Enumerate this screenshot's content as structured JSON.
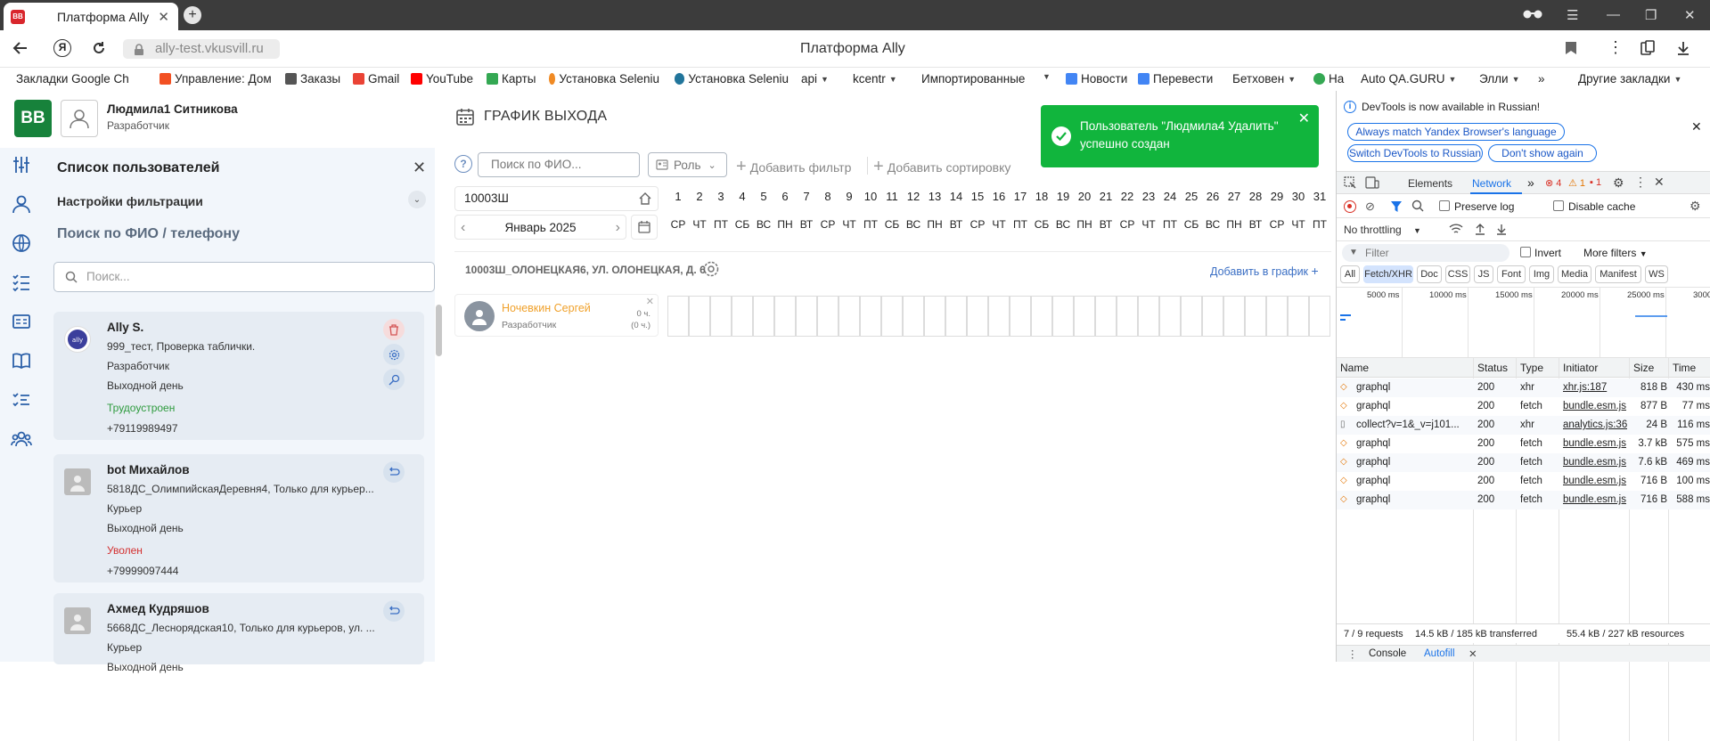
{
  "browser": {
    "tab_title": "Платформа Ally",
    "favicon_text": "BB",
    "url": "ally-test.vkusvill.ru",
    "page_title": "Платформа Ally"
  },
  "bookmarks": [
    {
      "label": "Закладки Google Ch",
      "color": "#4285f4"
    },
    {
      "label": "Управление: Дом",
      "color": "#f25022"
    },
    {
      "label": "Заказы",
      "color": "#555555"
    },
    {
      "label": "Gmail",
      "color": "#ea4335"
    },
    {
      "label": "YouTube",
      "color": "#ff0000"
    },
    {
      "label": "Карты",
      "color": "#34a853"
    },
    {
      "label": "Установка Seleniu",
      "color": "#f08a24"
    },
    {
      "label": "Установка Seleniu",
      "color": "#21759b"
    },
    {
      "label": "api",
      "color": ""
    },
    {
      "label": "kcentr",
      "color": ""
    },
    {
      "label": "Импортированные",
      "color": ""
    },
    {
      "label": "Новости",
      "color": "#4285f4"
    },
    {
      "label": "Перевести",
      "color": "#4285f4"
    },
    {
      "label": "Бетховен",
      "color": ""
    },
    {
      "label": "Ha",
      "color": "#34a853"
    },
    {
      "label": "Auto QA.GURU",
      "color": ""
    },
    {
      "label": "Элли",
      "color": ""
    },
    {
      "label": "»",
      "color": ""
    },
    {
      "label": "Другие закладки",
      "color": ""
    }
  ],
  "app": {
    "logo": "BB",
    "user_name": "Людмила1 Ситникова",
    "user_role": "Разработчик",
    "main_title": "ГРАФИК ВЫХОДА"
  },
  "panel": {
    "title": "Список пользователей",
    "filter_title": "Настройки фильтрации",
    "search_label": "Поиск по ФИО / телефону",
    "search_placeholder": "Поиск...",
    "users": [
      {
        "name": "Ally S.",
        "subtitle": "999_тест, Проверка таблички.",
        "role": "Разработчик",
        "day": "Выходной день",
        "status": "Трудоустроен",
        "status_color": "#2e9b3e",
        "phone": "+79119989497"
      },
      {
        "name": "bot Михайлов",
        "subtitle": "5818ДС_ОлимпийскаяДеревня4, Только для курьер...",
        "role": "Курьер",
        "day": "Выходной день",
        "status": "Уволен",
        "status_color": "#d32f2f",
        "phone": "+79999097444"
      },
      {
        "name": "Ахмед Кудряшов",
        "subtitle": "5668ДС_Леснорядская10, Только для курьеров, ул. ...",
        "role": "Курьер",
        "day": "Выходной день"
      }
    ]
  },
  "toolbar": {
    "search_placeholder": "Поиск по ФИО...",
    "role_label": "Роль",
    "add_filter": "Добавить фильтр",
    "add_sort": "Добавить сортировку"
  },
  "schedule": {
    "store": "10003Ш",
    "month": "Январь 2025",
    "days": [
      "1",
      "2",
      "3",
      "4",
      "5",
      "6",
      "7",
      "8",
      "9",
      "10",
      "11",
      "12",
      "13",
      "14",
      "15",
      "16",
      "17",
      "18",
      "19",
      "20",
      "21",
      "22",
      "23",
      "24",
      "25",
      "26",
      "27",
      "28",
      "29",
      "30",
      "31"
    ],
    "weekdays": [
      "СР",
      "ЧТ",
      "ПТ",
      "СБ",
      "ВС",
      "ПН",
      "ВТ",
      "СР",
      "ЧТ",
      "ПТ",
      "СБ",
      "ВС",
      "ПН",
      "ВТ",
      "СР",
      "ЧТ",
      "ПТ",
      "СБ",
      "ВС",
      "ПН",
      "ВТ",
      "СР",
      "ЧТ",
      "ПТ",
      "СБ",
      "ВС",
      "ПН",
      "ВТ",
      "СР",
      "ЧТ",
      "ПТ"
    ],
    "address": "10003Ш_ОЛОНЕЦКАЯ6, УЛ. ОЛОНЕЦКАЯ, Д. 6",
    "add_to_schedule": "Добавить в график",
    "employee": {
      "name": "Ночевкин Сергей",
      "role": "Разработчик",
      "hours1": "0 ч.",
      "hours2": "(0 ч.)"
    }
  },
  "toast": {
    "message": "Пользователь \"Людмила4 Удалить\" успешно создан"
  },
  "devtools": {
    "banner": "DevTools is now available in Russian!",
    "btn_match": "Always match Yandex Browser's language",
    "btn_switch": "Switch DevTools to Russian",
    "btn_dont": "Don't show again",
    "tabs": [
      "Elements",
      "Network"
    ],
    "errors": "4",
    "warnings": "1",
    "issues": "1",
    "preserve_log": "Preserve log",
    "disable_cache": "Disable cache",
    "throttling": "No throttling",
    "filter_placeholder": "Filter",
    "invert": "Invert",
    "more_filters": "More filters",
    "type_filters": [
      "All",
      "Fetch/XHR",
      "Doc",
      "CSS",
      "JS",
      "Font",
      "Img",
      "Media",
      "Manifest",
      "WS"
    ],
    "timeline_labels": [
      "5000 ms",
      "10000 ms",
      "15000 ms",
      "20000 ms",
      "25000 ms",
      "3000"
    ],
    "columns": [
      "Name",
      "Status",
      "Type",
      "Initiator",
      "Size",
      "Time"
    ],
    "rows": [
      {
        "name": "graphql",
        "status": "200",
        "type": "xhr",
        "initiator": "xhr.js:187",
        "size": "818 B",
        "time": "430 ms"
      },
      {
        "name": "graphql",
        "status": "200",
        "type": "fetch",
        "initiator": "bundle.esm.js",
        "size": "877 B",
        "time": "77 ms"
      },
      {
        "name": "collect?v=1&_v=j101...",
        "status": "200",
        "type": "xhr",
        "initiator": "analytics.js:36",
        "size": "24 B",
        "time": "116 ms"
      },
      {
        "name": "graphql",
        "status": "200",
        "type": "fetch",
        "initiator": "bundle.esm.js",
        "size": "3.7 kB",
        "time": "575 ms"
      },
      {
        "name": "graphql",
        "status": "200",
        "type": "fetch",
        "initiator": "bundle.esm.js",
        "size": "7.6 kB",
        "time": "469 ms"
      },
      {
        "name": "graphql",
        "status": "200",
        "type": "fetch",
        "initiator": "bundle.esm.js",
        "size": "716 B",
        "time": "100 ms"
      },
      {
        "name": "graphql",
        "status": "200",
        "type": "fetch",
        "initiator": "bundle.esm.js",
        "size": "716 B",
        "time": "588 ms"
      }
    ],
    "summary_requests": "7 / 9 requests",
    "summary_transferred": "14.5 kB / 185 kB transferred",
    "summary_resources": "55.4 kB / 227 kB resources",
    "drawer_tabs": [
      "Console",
      "Autofill"
    ]
  }
}
